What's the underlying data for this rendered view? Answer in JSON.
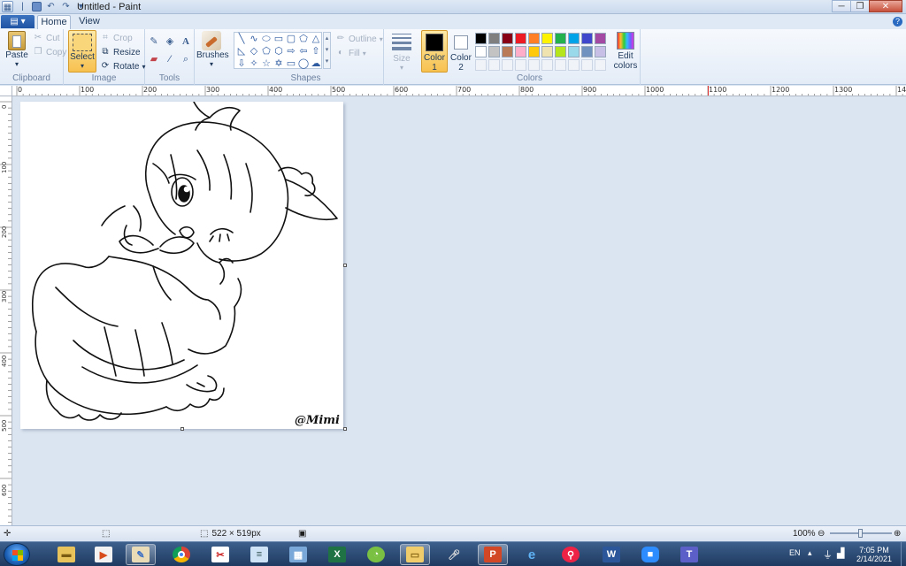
{
  "window": {
    "title": "Untitled - Paint",
    "minimize_glyph": "─",
    "maximize_glyph": "❐",
    "close_glyph": "✕"
  },
  "tabs": {
    "file": "▤ ▾",
    "home": "Home",
    "view": "View"
  },
  "ribbon": {
    "clipboard": {
      "label": "Clipboard",
      "paste": "Paste",
      "cut": "Cut",
      "copy": "Copy"
    },
    "image": {
      "label": "Image",
      "select": "Select",
      "crop": "Crop",
      "resize": "Resize",
      "rotate": "Rotate"
    },
    "tools": {
      "label": "Tools"
    },
    "brushes": {
      "label": "Brushes"
    },
    "shapes": {
      "label": "Shapes",
      "outline": "Outline",
      "fill": "Fill",
      "glyphs": [
        "╲",
        "∿",
        "⬭",
        "▭",
        "▢",
        "⬠",
        "△",
        "◺",
        "◇",
        "⬠",
        "⬡",
        "⇨",
        "⇦",
        "⇧",
        "⇩",
        "✧",
        "☆",
        "✡",
        "▭",
        "◯",
        "☁"
      ]
    },
    "size": {
      "label": "Size"
    },
    "colors": {
      "label": "Colors",
      "color1": "Color\n1",
      "color1_line1": "Color",
      "color1_line2": "1",
      "color2_line1": "Color",
      "color2_line2": "2",
      "edit_line1": "Edit",
      "edit_line2": "colors",
      "color1_value": "#000000",
      "color2_value": "#ffffff",
      "palette_row1": [
        "#000000",
        "#7f7f7f",
        "#880015",
        "#ed1c24",
        "#ff7f27",
        "#fff200",
        "#22b14c",
        "#00a2e8",
        "#3f48cc",
        "#a349a4"
      ],
      "palette_row2": [
        "#ffffff",
        "#c3c3c3",
        "#b97a57",
        "#ffaec9",
        "#ffc90e",
        "#efe4b0",
        "#b5e61d",
        "#99d9ea",
        "#7092be",
        "#c8bfe7"
      ]
    }
  },
  "rulers": {
    "horizontal": [
      "0",
      "100",
      "200",
      "300",
      "400",
      "500",
      "600",
      "700",
      "800",
      "900",
      "1000",
      "1100",
      "1200",
      "1300",
      "14"
    ],
    "vertical": [
      "0",
      "100",
      "200",
      "300",
      "400",
      "500",
      "600"
    ]
  },
  "canvas": {
    "signature": "@Mimi"
  },
  "status": {
    "image_size": "522 × 519px",
    "zoom": "100%",
    "zoom_level": 1.0
  },
  "taskbar": {
    "language": "EN",
    "time": "7:05 PM",
    "date": "2/14/2021"
  }
}
